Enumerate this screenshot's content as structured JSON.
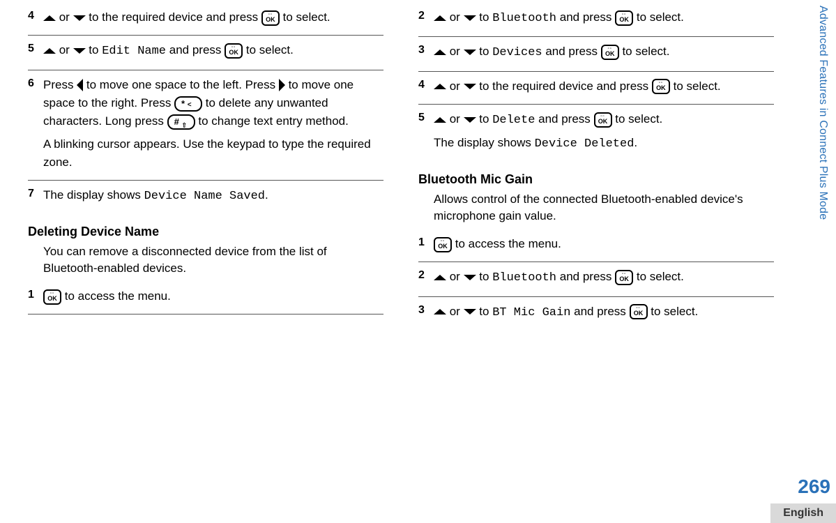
{
  "sideTab": "Advanced Features in Connect Plus Mode",
  "pageNumber": "269",
  "footerLang": "English",
  "left": {
    "steps": [
      {
        "num": "4",
        "lines": [
          {
            "type": "nav-ok",
            "text1": " or ",
            "text2": " to the required device and press ",
            "text3": " to select."
          }
        ]
      },
      {
        "num": "5",
        "lines": [
          {
            "type": "nav-mono-ok",
            "text1": " or ",
            "text2": " to ",
            "mono": "Edit Name",
            "text3": " and press ",
            "text4": " to select."
          }
        ]
      },
      {
        "num": "6",
        "lines": [
          {
            "type": "editkeys",
            "part1": "Press ",
            "part2": " to move one space to the left. Press ",
            "part3": " to move one space to the right. Press ",
            "part4": " to delete any unwanted characters. Long press ",
            "part5": " to change text entry method."
          },
          {
            "type": "plain",
            "text": "A blinking cursor appears. Use the keypad to type the required zone."
          }
        ]
      },
      {
        "num": "7",
        "noborder": true,
        "lines": [
          {
            "type": "plain-mono",
            "text1": "The display shows ",
            "mono": "Device Name Saved",
            "text2": "."
          }
        ]
      }
    ],
    "section": {
      "title": "Deleting Device Name",
      "intro": "You can remove a disconnected device from the list of Bluetooth-enabled devices.",
      "steps": [
        {
          "num": "1",
          "lines": [
            {
              "type": "ok-only",
              "text": " to access the menu."
            }
          ]
        }
      ]
    }
  },
  "right": {
    "steps": [
      {
        "num": "2",
        "lines": [
          {
            "type": "nav-mono-ok",
            "text1": " or ",
            "text2": " to ",
            "mono": "Bluetooth",
            "text3": " and press ",
            "text4": " to select."
          }
        ]
      },
      {
        "num": "3",
        "lines": [
          {
            "type": "nav-mono-ok",
            "text1": " or ",
            "text2": " to ",
            "mono": "Devices",
            "text3": " and press ",
            "text4": " to select."
          }
        ]
      },
      {
        "num": "4",
        "lines": [
          {
            "type": "nav-ok",
            "text1": " or ",
            "text2": " to the required device and press ",
            "text3": " to select."
          }
        ]
      },
      {
        "num": "5",
        "noborder": true,
        "lines": [
          {
            "type": "nav-mono-ok",
            "text1": " or ",
            "text2": " to ",
            "mono": "Delete",
            "text3": " and press ",
            "text4": " to select."
          },
          {
            "type": "plain-mono",
            "text1": "The display shows ",
            "mono": "Device Deleted",
            "text2": "."
          }
        ]
      }
    ],
    "section": {
      "title": "Bluetooth Mic Gain",
      "intro": "Allows control of the connected Bluetooth-enabled device's microphone gain value.",
      "steps": [
        {
          "num": "1",
          "lines": [
            {
              "type": "ok-only",
              "text": " to access the menu."
            }
          ]
        },
        {
          "num": "2",
          "lines": [
            {
              "type": "nav-mono-ok",
              "text1": " or ",
              "text2": " to ",
              "mono": "Bluetooth",
              "text3": " and press ",
              "text4": " to select."
            }
          ]
        },
        {
          "num": "3",
          "noborder": true,
          "lines": [
            {
              "type": "nav-mono-ok",
              "text1": " or ",
              "text2": " to ",
              "mono": "BT Mic Gain",
              "text3": " and press ",
              "text4": " to select."
            }
          ]
        }
      ]
    }
  }
}
